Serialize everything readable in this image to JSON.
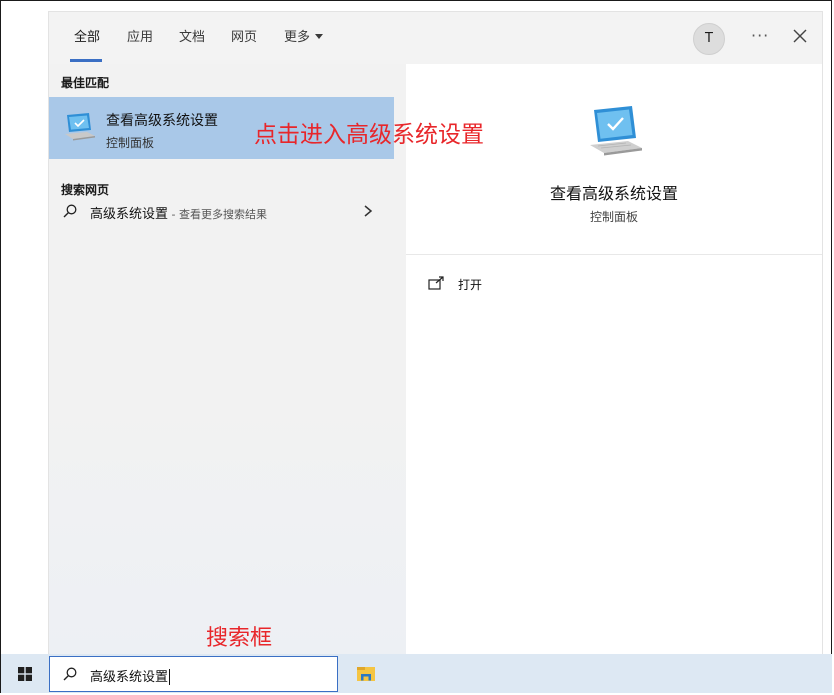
{
  "tabs": [
    {
      "label": "全部",
      "active": true
    },
    {
      "label": "应用",
      "active": false
    },
    {
      "label": "文档",
      "active": false
    },
    {
      "label": "网页",
      "active": false
    },
    {
      "label": "更多",
      "active": false,
      "dropdown": true
    }
  ],
  "header": {
    "avatar_letter": "T",
    "more_label": "···"
  },
  "left": {
    "best_match_label": "最佳匹配",
    "best_match": {
      "title": "查看高级系统设置",
      "subtitle": "控制面板",
      "icon": "monitor-icon"
    },
    "web_label": "搜索网页",
    "web_result": {
      "query": "高级系统设置",
      "hint": " - 查看更多搜索结果"
    }
  },
  "right": {
    "title": "查看高级系统设置",
    "subtitle": "控制面板",
    "actions": [
      {
        "label": "打开",
        "icon": "open-external-icon"
      }
    ]
  },
  "annotations": {
    "click_hint": "点击进入高级系统设置",
    "search_box_hint": "搜索框",
    "color": "#e8262a"
  },
  "taskbar": {
    "search_value": "高级系统设置",
    "icons": [
      "windows-start-icon",
      "file-explorer-icon"
    ]
  },
  "colors": {
    "accent": "#3a6fc4",
    "selection": "#a9c8e8",
    "taskbar": "#dde8f3"
  }
}
